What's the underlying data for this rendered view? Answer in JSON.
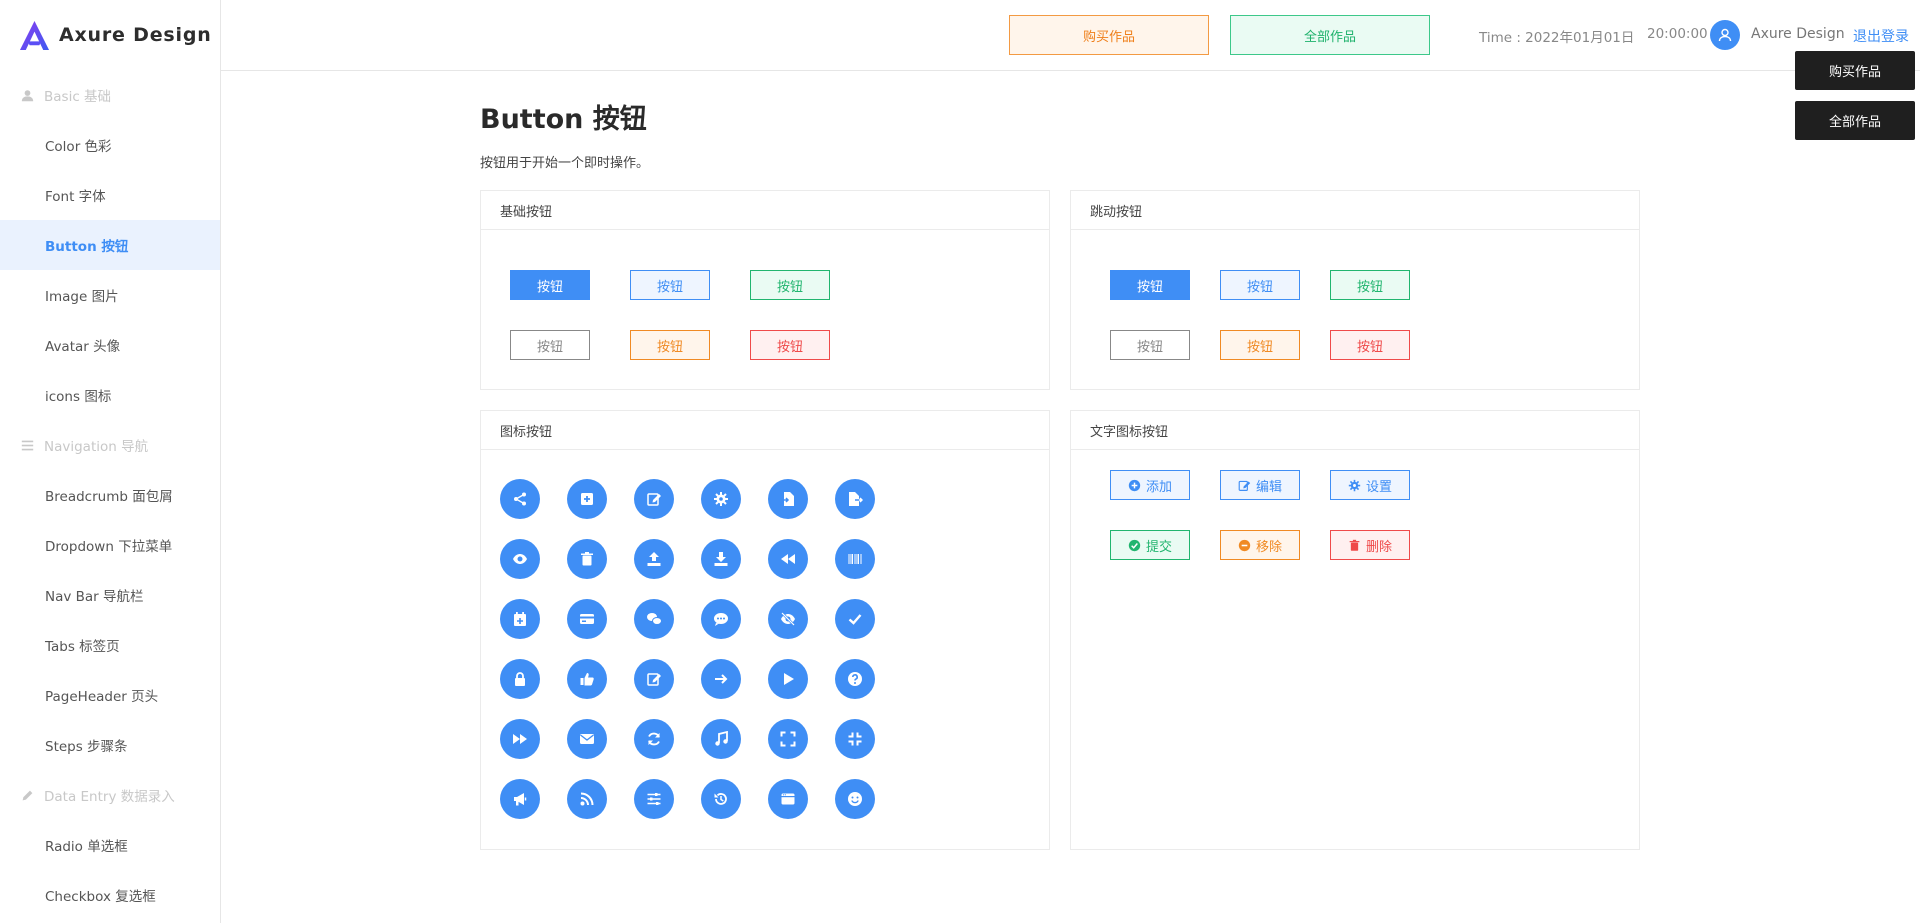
{
  "brand": {
    "name": "Axure Design"
  },
  "sidebar": {
    "groups": [
      {
        "label": "Basic 基础",
        "icon": "user-icon",
        "items": [
          "Color 色彩",
          "Font 字体",
          "Button 按钮",
          "Image 图片",
          "Avatar 头像",
          "icons 图标"
        ]
      },
      {
        "label": "Navigation 导航",
        "icon": "menu-icon",
        "items": [
          "Breadcrumb 面包屑",
          "Dropdown 下拉菜单",
          "Nav Bar 导航栏",
          "Tabs 标签页",
          "PageHeader 页头",
          "Steps 步骤条"
        ]
      },
      {
        "label": "Data Entry 数据录入",
        "icon": "pencil-icon",
        "items": [
          "Radio 单选框",
          "Checkbox 复选框"
        ]
      }
    ],
    "active": "Button 按钮"
  },
  "header": {
    "buy_label": "购买作品",
    "all_label": "全部作品",
    "time_label": "Time : 2022年01月01日",
    "clock": "20:00:00",
    "username": "Axure Design",
    "logout": "退出登录"
  },
  "floating": {
    "buy_label": "购买作品",
    "all_label": "全部作品"
  },
  "page": {
    "title": "Button 按钮",
    "description": "按钮用于开始一个即时操作。"
  },
  "cards": {
    "basic": {
      "title": "基础按钮",
      "button_label": "按钮"
    },
    "jump": {
      "title": "跳动按钮",
      "button_label": "按钮"
    },
    "icon": {
      "title": "图标按钮",
      "icons": [
        [
          "share-icon",
          "plus-square-icon",
          "edit-icon",
          "gear-icon",
          "file-import-icon",
          "file-export-icon"
        ],
        [
          "eye-icon",
          "trash-icon",
          "upload-icon",
          "download-icon",
          "rewind-icon",
          "barcode-icon"
        ],
        [
          "calendar-plus-icon",
          "credit-card-icon",
          "comments-icon",
          "comment-dots-icon",
          "eye-slash-icon",
          "check-icon"
        ],
        [
          "lock-icon",
          "thumbs-up-icon",
          "edit-icon",
          "arrow-right-icon",
          "play-icon",
          "question-icon"
        ],
        [
          "fast-forward-icon",
          "envelope-icon",
          "sync-icon",
          "music-icon",
          "expand-icon",
          "compress-icon"
        ],
        [
          "bullhorn-icon",
          "rss-icon",
          "sliders-icon",
          "history-icon",
          "window-icon",
          "smile-icon"
        ]
      ]
    },
    "text_icon": {
      "title": "文字图标按钮",
      "buttons": [
        {
          "label": "添加",
          "icon": "plus-circle-icon",
          "style": "blue"
        },
        {
          "label": "编辑",
          "icon": "edit-icon",
          "style": "blue"
        },
        {
          "label": "设置",
          "icon": "gear-icon",
          "style": "blue"
        },
        {
          "label": "提交",
          "icon": "check-circle-icon",
          "style": "green"
        },
        {
          "label": "移除",
          "icon": "minus-circle-icon",
          "style": "orange"
        },
        {
          "label": "删除",
          "icon": "trash-icon",
          "style": "red"
        }
      ]
    }
  },
  "colors": {
    "primary": "#3f8ef5",
    "green": "#22b56f",
    "orange": "#f08a24",
    "red": "#ef4a4a",
    "dark": "#1f1f1f"
  }
}
